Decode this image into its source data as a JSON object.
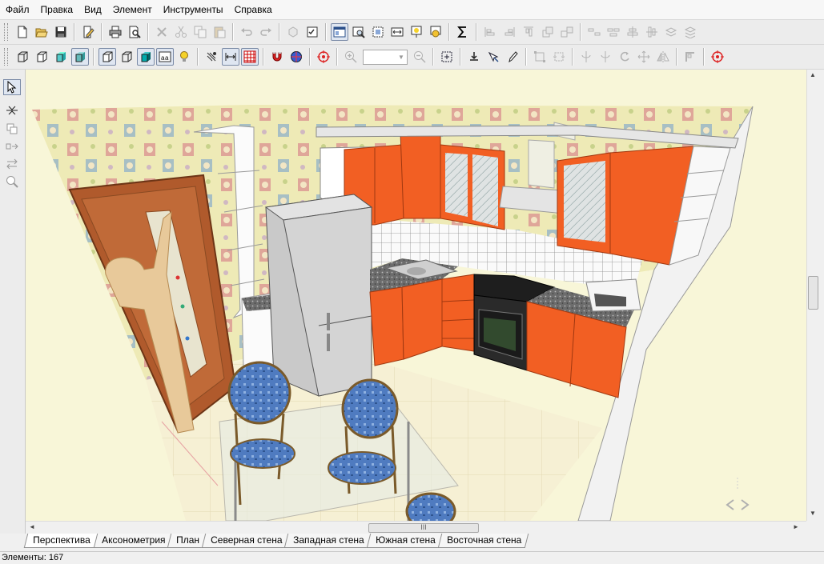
{
  "menu": {
    "items": [
      "Файл",
      "Правка",
      "Вид",
      "Элемент",
      "Инструменты",
      "Справка"
    ]
  },
  "tabs": [
    {
      "label": "Перспектива",
      "active": true
    },
    {
      "label": "Аксонометрия",
      "active": false
    },
    {
      "label": "План",
      "active": false
    },
    {
      "label": "Северная стена",
      "active": false
    },
    {
      "label": "Западная стена",
      "active": false
    },
    {
      "label": "Южная стена",
      "active": false
    },
    {
      "label": "Восточная стена",
      "active": false
    }
  ],
  "status": {
    "elements_label": "Элементы: 167"
  },
  "zoom": {
    "value": ""
  },
  "scene": {
    "colors": {
      "background": "#f8f6d8",
      "cabinet_orange": "#f25f23",
      "wallpaper": "#efeab8",
      "door": "#b05a2c",
      "chair_blue": "#4f7bc0",
      "fridge": "#c9c9c9",
      "tiles": "#ffffff"
    }
  },
  "scrollbar": {
    "h_thumb_grip": "III"
  }
}
